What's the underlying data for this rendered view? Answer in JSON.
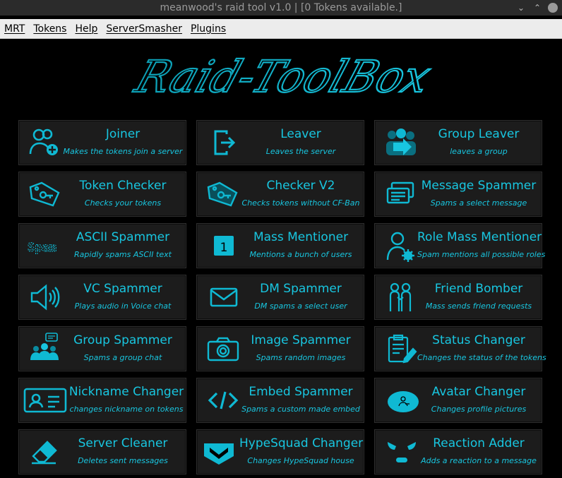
{
  "window": {
    "title": "meanwood's raid tool v1.0 | [0 Tokens available.]"
  },
  "menu": [
    "MRT",
    "Tokens",
    "Help",
    "ServerSmasher",
    "Plugins"
  ],
  "logo_text": "Raid-ToolBox",
  "accent_color": "#18c6e0",
  "tiles": [
    {
      "title": "Joiner",
      "subtitle": "Makes the tokens join a server",
      "icon": "user-add-icon"
    },
    {
      "title": "Leaver",
      "subtitle": "Leaves the server",
      "icon": "exit-icon"
    },
    {
      "title": "Group Leaver",
      "subtitle": "leaves a group",
      "icon": "group-leave-icon"
    },
    {
      "title": "Token Checker",
      "subtitle": "Checks your tokens",
      "icon": "key-tag-icon"
    },
    {
      "title": "Checker V2",
      "subtitle": "Checks tokens without CF-Ban",
      "icon": "key-tag-icon"
    },
    {
      "title": "Message Spammer",
      "subtitle": "Spams a select message",
      "icon": "messages-icon"
    },
    {
      "title": "ASCII Spammer",
      "subtitle": "Rapidly spams ASCII text",
      "icon": "spam-text-icon",
      "icon_text": "Spam"
    },
    {
      "title": "Mass Mentioner",
      "subtitle": "Mentions a bunch of users",
      "icon": "number-badge-icon",
      "icon_text": "1"
    },
    {
      "title": "Role Mass Mentioner",
      "subtitle": "Spam mentions all possible roles",
      "icon": "user-settings-icon"
    },
    {
      "title": "VC Spammer",
      "subtitle": "Plays audio in Voice chat",
      "icon": "speaker-icon"
    },
    {
      "title": "DM Spammer",
      "subtitle": "DM spams a select user",
      "icon": "envelope-icon"
    },
    {
      "title": "Friend Bomber",
      "subtitle": "Mass sends friend requests",
      "icon": "friends-icon"
    },
    {
      "title": "Group Spammer",
      "subtitle": "Spams a group chat",
      "icon": "group-chat-icon"
    },
    {
      "title": "Image Spammer",
      "subtitle": "Spams random images",
      "icon": "camera-icon"
    },
    {
      "title": "Status Changer",
      "subtitle": "Changes the status of the tokens",
      "icon": "clipboard-edit-icon"
    },
    {
      "title": "Nickname Changer",
      "subtitle": "changes nickname on tokens",
      "icon": "id-card-icon"
    },
    {
      "title": "Embed Spammer",
      "subtitle": "Spams a custom made embed",
      "icon": "code-icon"
    },
    {
      "title": "Avatar Changer",
      "subtitle": "Changes profile pictures",
      "icon": "avatar-icon"
    },
    {
      "title": "Server Cleaner",
      "subtitle": "Deletes sent messages",
      "icon": "eraser-icon"
    },
    {
      "title": "HypeSquad Changer",
      "subtitle": "Changes HypeSquad house",
      "icon": "hypesquad-icon"
    },
    {
      "title": "Reaction Adder",
      "subtitle": "Adds a reaction to a message",
      "icon": "angry-face-icon"
    }
  ]
}
